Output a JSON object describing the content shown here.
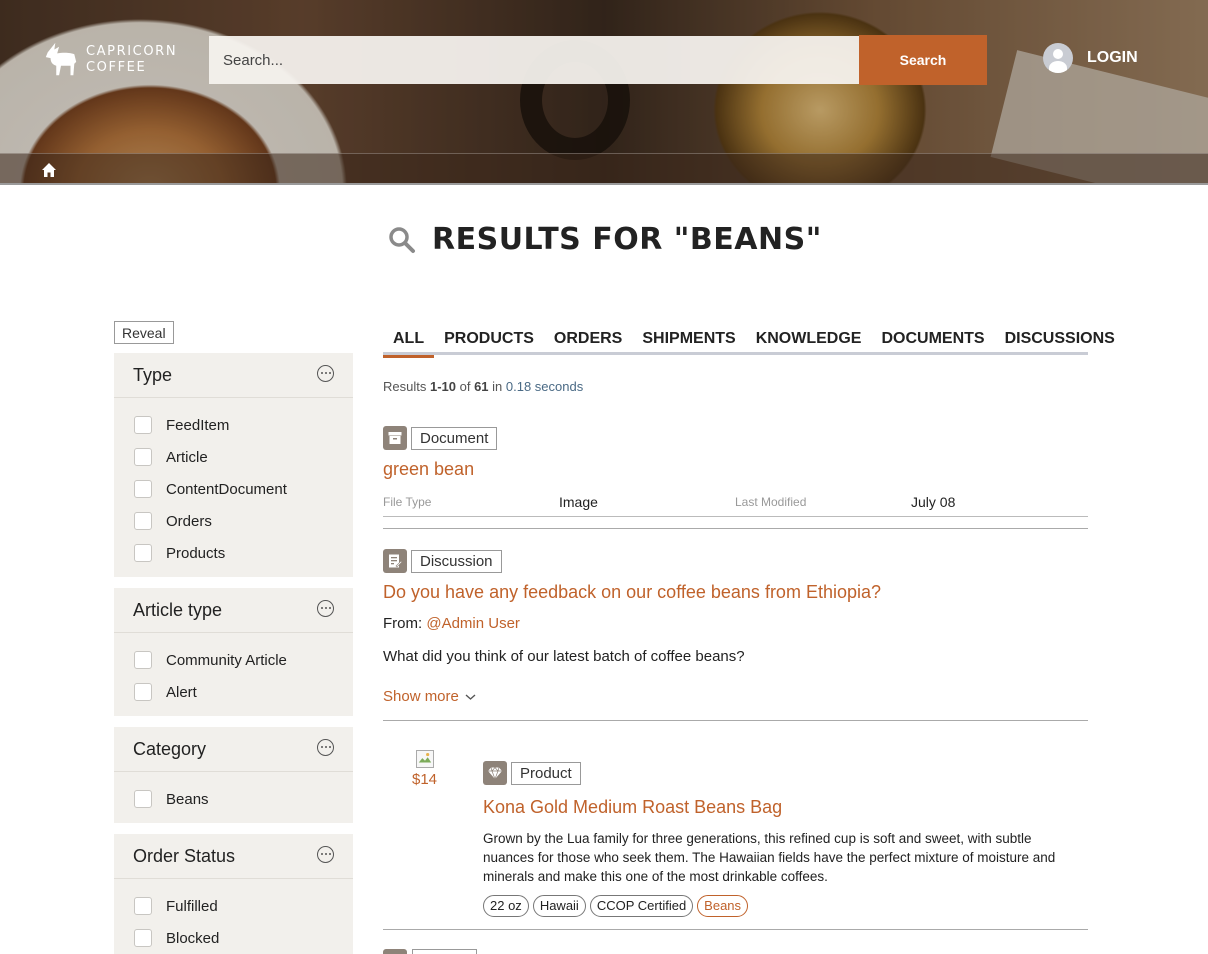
{
  "brand": {
    "line1": "CAPRICORN",
    "line2": "COFFEE"
  },
  "header": {
    "search_placeholder": "Search...",
    "search_button": "Search",
    "login_label": "LOGIN"
  },
  "page": {
    "title": "RESULTS FOR \"BEANS\""
  },
  "sidebar": {
    "reveal_label": "Reveal",
    "facets": [
      {
        "title": "Type",
        "options": [
          "FeedItem",
          "Article",
          "ContentDocument",
          "Orders",
          "Products"
        ]
      },
      {
        "title": "Article type",
        "options": [
          "Community Article",
          "Alert"
        ]
      },
      {
        "title": "Category",
        "options": [
          "Beans"
        ]
      },
      {
        "title": "Order Status",
        "options": [
          "Fulfilled",
          "Blocked"
        ]
      }
    ]
  },
  "tabs": [
    "ALL",
    "PRODUCTS",
    "ORDERS",
    "SHIPMENTS",
    "KNOWLEDGE",
    "DOCUMENTS",
    "DISCUSSIONS"
  ],
  "results_summary": {
    "prefix": "Results ",
    "range": "1-10",
    "of": " of ",
    "total": "61",
    "in": " in ",
    "time": "0.18 seconds"
  },
  "results": [
    {
      "type": "Document",
      "title": "green bean",
      "meta": {
        "file_type_label": "File Type",
        "file_type": "Image",
        "modified_label": "Last Modified",
        "modified": "July 08"
      }
    },
    {
      "type": "Discussion",
      "title": "Do you have any feedback on our coffee beans from Ethiopia?",
      "from_label": "From: ",
      "author": "@Admin User",
      "body": "What did you think of our latest batch of coffee beans?",
      "show_more": "Show more"
    },
    {
      "type": "Product",
      "price": "$14",
      "title": "Kona Gold Medium Roast Beans Bag",
      "description": "Grown by the Lua family for three generations, this refined cup is soft and sweet, with subtle nuances for those who seek them. The Hawaiian fields have the perfect mixture of moisture and minerals and make this one of the most drinkable coffees.",
      "tags": [
        "22 oz",
        "Hawaii",
        "CCOP Certified",
        "Beans"
      ]
    }
  ],
  "colors": {
    "accent": "#c0622b",
    "facet_bg": "#f2f0ec",
    "icon_bg": "#8e8379"
  }
}
